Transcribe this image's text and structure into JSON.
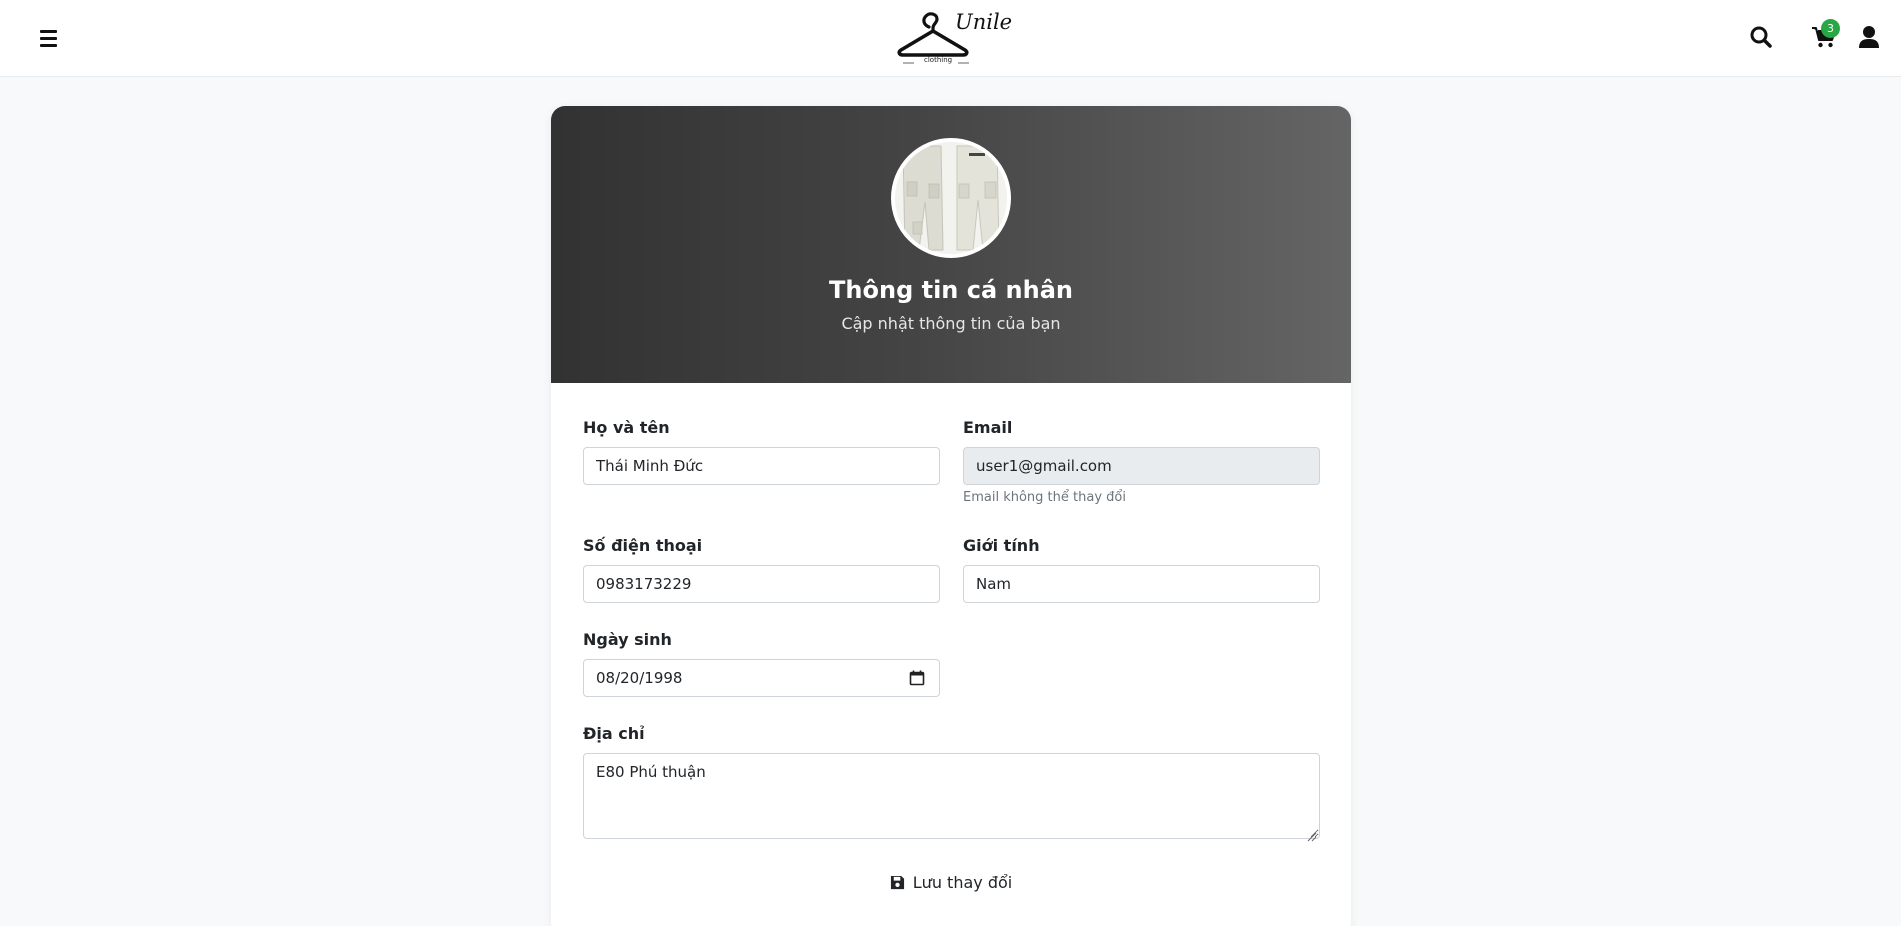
{
  "header": {
    "logo_script": "Unile",
    "logo_sub": "clothing",
    "cart_count": "3"
  },
  "profile": {
    "title": "Thông tin cá nhân",
    "subtitle": "Cập nhật thông tin của bạn"
  },
  "form": {
    "fullname": {
      "label": "Họ và tên",
      "value": "Thái Minh Đức"
    },
    "email": {
      "label": "Email",
      "value": "user1@gmail.com",
      "helper": "Email không thể thay đổi"
    },
    "phone": {
      "label": "Số điện thoại",
      "value": "0983173229"
    },
    "gender": {
      "label": "Giới tính",
      "value": "Nam"
    },
    "birthday": {
      "label": "Ngày sinh",
      "value": "08/20/1998"
    },
    "address": {
      "label": "Địa chỉ",
      "value": "E80 Phú thuận"
    },
    "save_label": "Lưu thay đổi"
  },
  "icons": {
    "menu": "hamburger-menu-icon",
    "search": "search-icon",
    "cart": "shopping-cart-icon",
    "user": "user-icon",
    "calendar": "calendar-icon",
    "save": "floppy-disk-icon"
  },
  "colors": {
    "header_gradient_start": "#323232",
    "header_gradient_end": "#656565",
    "badge": "#28a745",
    "page_bg": "#f8f9fa"
  }
}
